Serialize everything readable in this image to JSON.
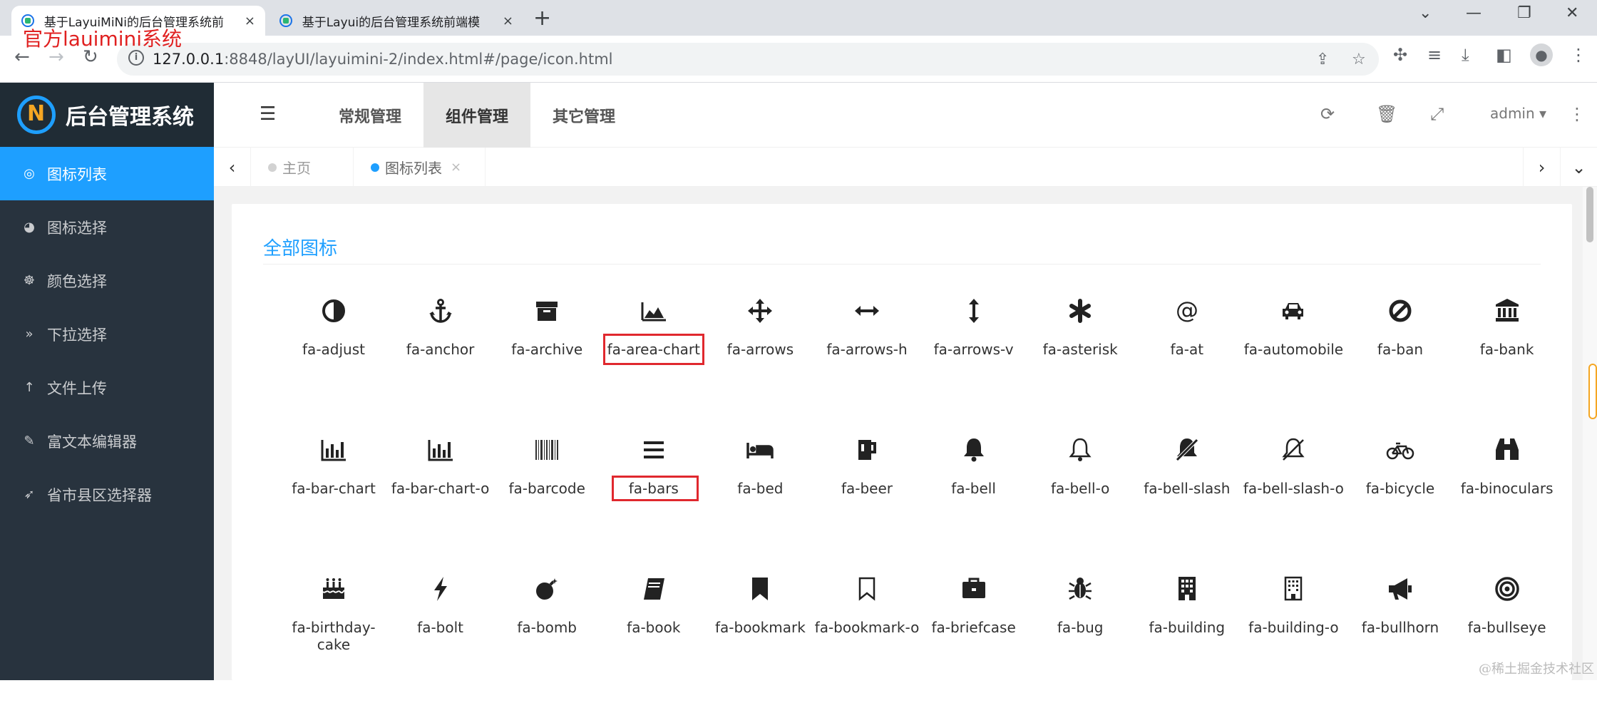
{
  "browser": {
    "tabs": [
      {
        "title": "基于LayuiMiNi的后台管理系统前",
        "close": "×"
      },
      {
        "title": "基于Layui的后台管理系统前端模",
        "close": "×"
      }
    ],
    "new_tab": "+",
    "window_controls": {
      "minimize": "—",
      "maximize": "❐",
      "close": "✕",
      "dropdown": "⌄"
    },
    "url_host": "127.0.0.1",
    "url_rest": ":8848/layUI/layuimini-2/index.html#/page/icon.html",
    "info_icon": "i"
  },
  "annotation": "官方lauimini系统",
  "app": {
    "logo_text": "后台管理系统",
    "sidebar": [
      {
        "label": "图标列表",
        "icon": "target-icon",
        "glyph": "◎",
        "active": true
      },
      {
        "label": "图标选择",
        "icon": "tachometer-icon",
        "glyph": "◕",
        "active": false
      },
      {
        "label": "颜色选择",
        "icon": "palette-icon",
        "glyph": "☸",
        "active": false
      },
      {
        "label": "下拉选择",
        "icon": "angle-double-down-icon",
        "glyph": "»",
        "active": false
      },
      {
        "label": "文件上传",
        "icon": "arrow-up-icon",
        "glyph": "↑",
        "active": false
      },
      {
        "label": "富文本编辑器",
        "icon": "edit-icon",
        "glyph": "✎",
        "active": false
      },
      {
        "label": "省市县区选择器",
        "icon": "rocket-icon",
        "glyph": "➶",
        "active": false
      }
    ],
    "top_nav": [
      {
        "label": "常规管理",
        "active": false
      },
      {
        "label": "组件管理",
        "active": true
      },
      {
        "label": "其它管理",
        "active": false
      }
    ],
    "user": "admin",
    "page_tabs": [
      {
        "label": "主页",
        "active": false
      },
      {
        "label": "图标列表",
        "active": true,
        "close": "×"
      }
    ],
    "section_title": "全部图标",
    "icons": [
      [
        "fa-adjust",
        "fa-anchor",
        "fa-archive",
        "fa-area-chart",
        "fa-arrows",
        "fa-arrows-h",
        "fa-arrows-v",
        "fa-asterisk",
        "fa-at",
        "fa-automobile",
        "fa-ban",
        "fa-bank"
      ],
      [
        "fa-bar-chart",
        "fa-bar-chart-o",
        "fa-barcode",
        "fa-bars",
        "fa-bed",
        "fa-beer",
        "fa-bell",
        "fa-bell-o",
        "fa-bell-slash",
        "fa-bell-slash-o",
        "fa-bicycle",
        "fa-binoculars"
      ],
      [
        "fa-birthday-cake",
        "fa-bolt",
        "fa-bomb",
        "fa-book",
        "fa-bookmark",
        "fa-bookmark-o",
        "fa-briefcase",
        "fa-bug",
        "fa-building",
        "fa-building-o",
        "fa-bullhorn",
        "fa-bullseye"
      ]
    ],
    "highlighted": [
      "fa-area-chart",
      "fa-bars"
    ]
  },
  "watermark": "@稀土掘金技术社区",
  "colors": {
    "accent": "#1e9fff",
    "sidebar": "#28333e",
    "highlight": "#e0282e"
  }
}
